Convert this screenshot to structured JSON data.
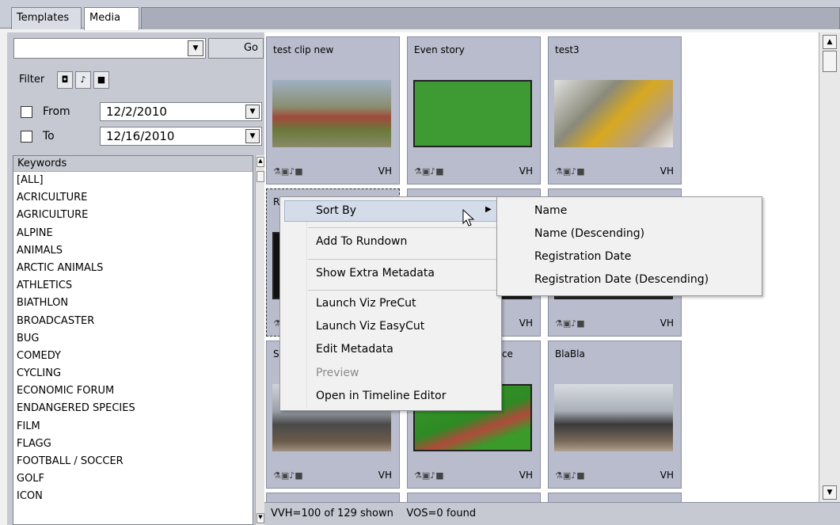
{
  "tabs": [
    "Templates",
    "Media"
  ],
  "search": {
    "value": "",
    "go_label": "Go"
  },
  "filter": {
    "label": "Filter",
    "buttons": [
      "camera-icon",
      "music-icon",
      "video-icon"
    ]
  },
  "date_from": {
    "label": "From",
    "value": "12/2/2010",
    "checked": false
  },
  "date_to": {
    "label": "To",
    "value": "12/16/2010",
    "checked": false
  },
  "keywords": {
    "header": "Keywords",
    "items": [
      "[ALL]",
      "ACRICULTURE",
      "AGRICULTURE",
      "ALPINE",
      "ANIMALS",
      "ARCTIC ANIMALS",
      "ATHLETICS",
      "BIATHLON",
      "BROADCASTER",
      "BUG",
      "COMEDY",
      "CYCLING",
      "ECONOMIC FORUM",
      "ENDANGERED SPECIES",
      "FILM",
      "FLAGG",
      "FOOTBALL / SOCCER",
      "GOLF",
      "ICON"
    ]
  },
  "cards": [
    {
      "title": "test clip new",
      "icons": "⚗▣♪■",
      "badge": "VH"
    },
    {
      "title": "Even story",
      "icons": "⚗▣♪■",
      "badge": "VH"
    },
    {
      "title": "test3",
      "icons": "⚗▣♪■",
      "badge": "VH"
    },
    {
      "title": "R",
      "icons": "⚗",
      "badge": ""
    },
    {
      "title": "",
      "icons": "",
      "badge": "VH"
    },
    {
      "title": "",
      "icons": "⚗▣♪■",
      "badge": "VH"
    },
    {
      "title": "S",
      "icons": "⚗▣♪■",
      "badge": "VH"
    },
    {
      "title": "ance",
      "icons": "⚗▣♪■",
      "badge": "VH"
    },
    {
      "title": "BlaBla",
      "icons": "⚗▣♪■",
      "badge": "VH"
    }
  ],
  "status": {
    "left": "VVH=100 of 129 shown",
    "right": "VOS=0 found"
  },
  "context_menu": {
    "items": [
      "Sort By",
      "Add To Rundown",
      "Show Extra Metadata",
      "Launch Viz PreCut",
      "Launch Viz EasyCut",
      "Edit Metadata",
      "Preview",
      "Open in Timeline Editor"
    ],
    "disabled": [
      "Preview"
    ]
  },
  "submenu": {
    "items": [
      "Name",
      "Name (Descending)",
      "Registration Date",
      "Registration Date (Descending)"
    ]
  },
  "colors": {
    "panel": "#c6c9d2",
    "card": "#b8bccc",
    "highlight": "#d4dcea"
  }
}
